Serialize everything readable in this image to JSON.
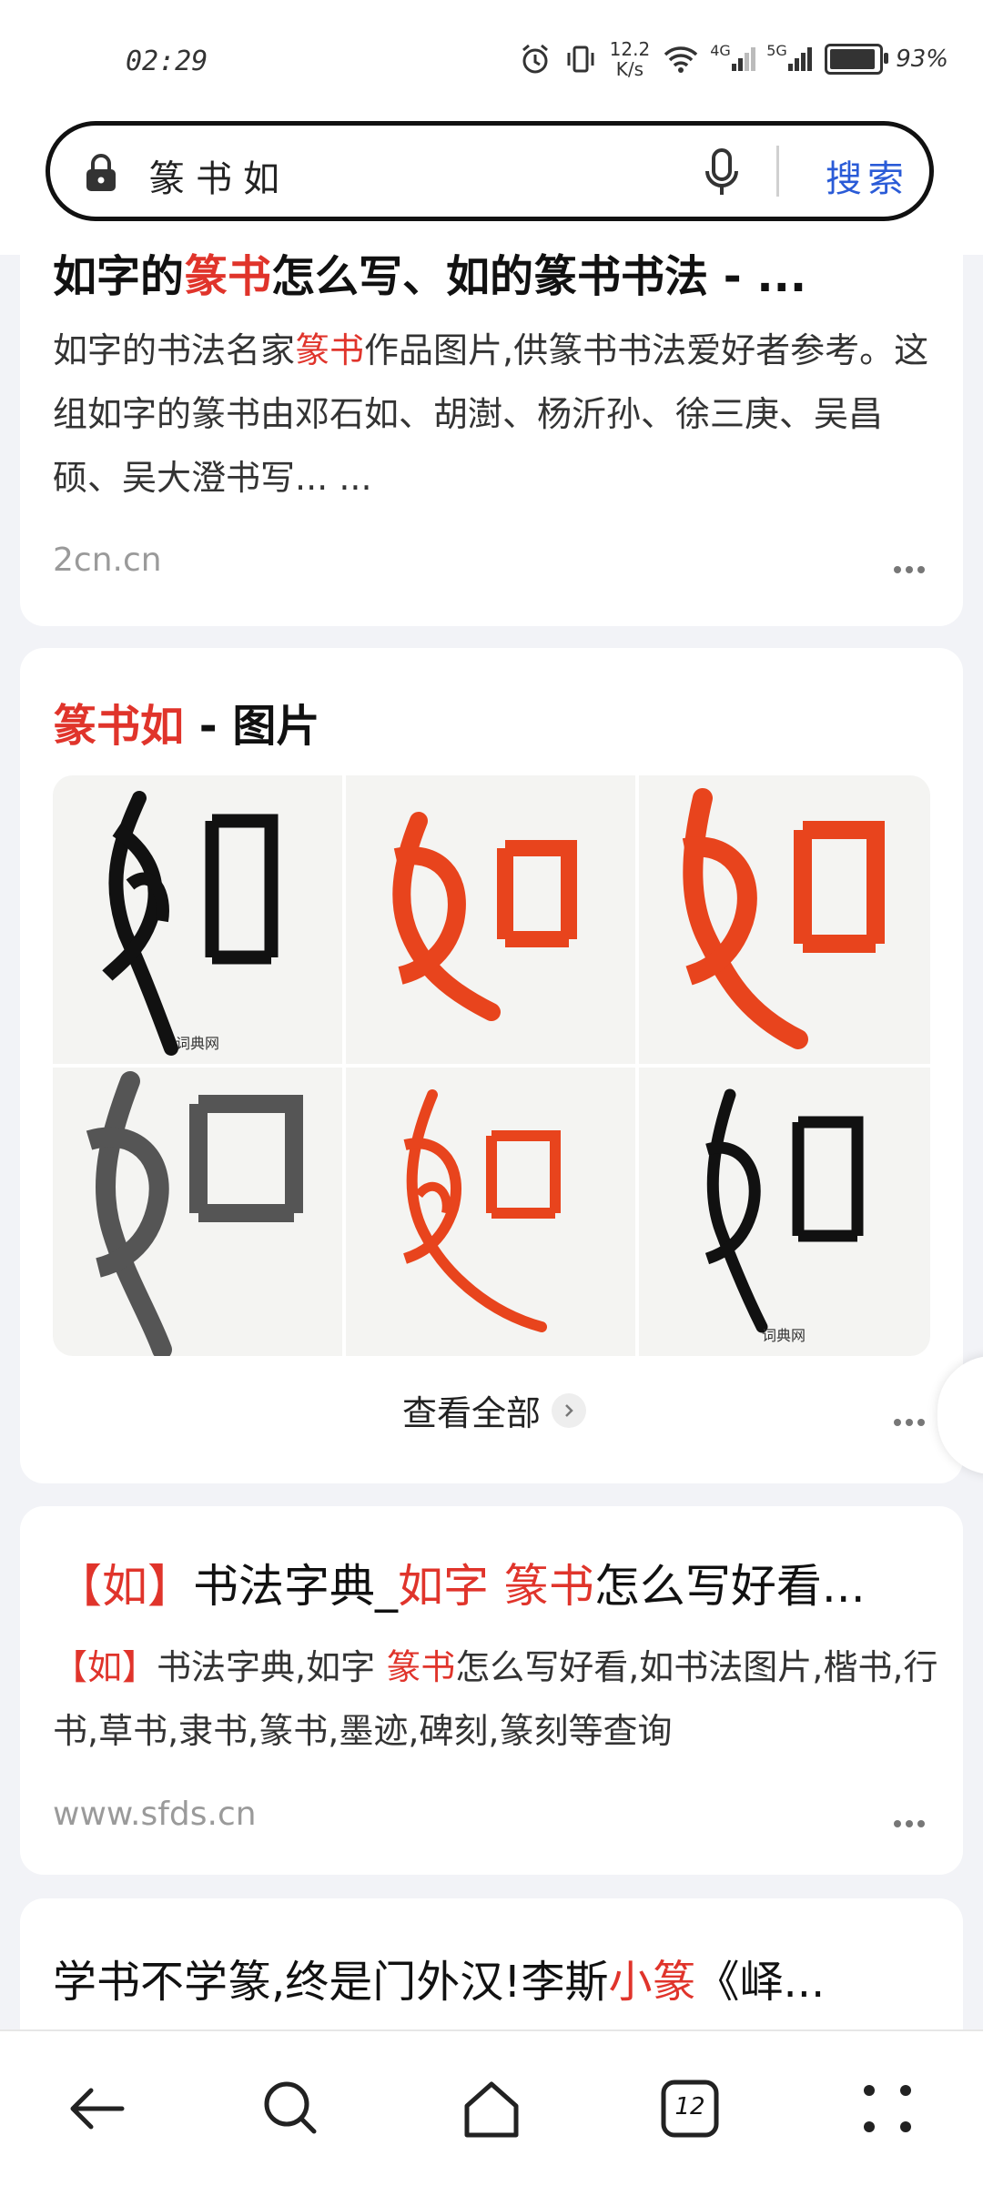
{
  "status": {
    "time": "02:29",
    "speed_value": "12.2",
    "speed_unit": "K/s",
    "net1": "4G",
    "net2": "5G",
    "battery_text": "93%",
    "battery_level": 0.93
  },
  "search": {
    "query": "篆书如",
    "button": "搜索"
  },
  "result1": {
    "title_pre": "如字的",
    "title_hl": "篆书",
    "title_post": "怎么写、如的篆书书法 - ...",
    "snippet_pre": "如字的书法名家",
    "snippet_hl": "篆书",
    "snippet_post": "作品图片,供篆书书法爱好者参考。这组如字的篆书由邓石如、胡澍、杨沂孙、徐三庚、吴昌硕、吴大澄书写... ...",
    "source": "2cn.cn"
  },
  "images": {
    "title_hl": "篆书如",
    "title_post": " - 图片",
    "watermark": "词典网",
    "view_all": "查看全部"
  },
  "result2": {
    "title_hl1": "【如】",
    "title_mid": "书法字典_",
    "title_hl2": "如字 篆书",
    "title_post": "怎么写好看...",
    "snippet_hl1": "【如】",
    "snippet_mid": "书法字典,如字 ",
    "snippet_hl2": "篆书",
    "snippet_post": "怎么写好看,如书法图片,楷书,行书,草书,隶书,篆书,墨迹,碑刻,篆刻等查询",
    "source": "www.sfds.cn"
  },
  "result3": {
    "title_pre": "学书不学篆,终是门外汉!李斯",
    "title_hl": "小篆",
    "title_post": "《峄..."
  },
  "nav": {
    "tabs_count": "12"
  },
  "colors": {
    "highlight": "#e0342b",
    "search_button": "#2a5bd7",
    "seal_red": "#e8441d"
  }
}
